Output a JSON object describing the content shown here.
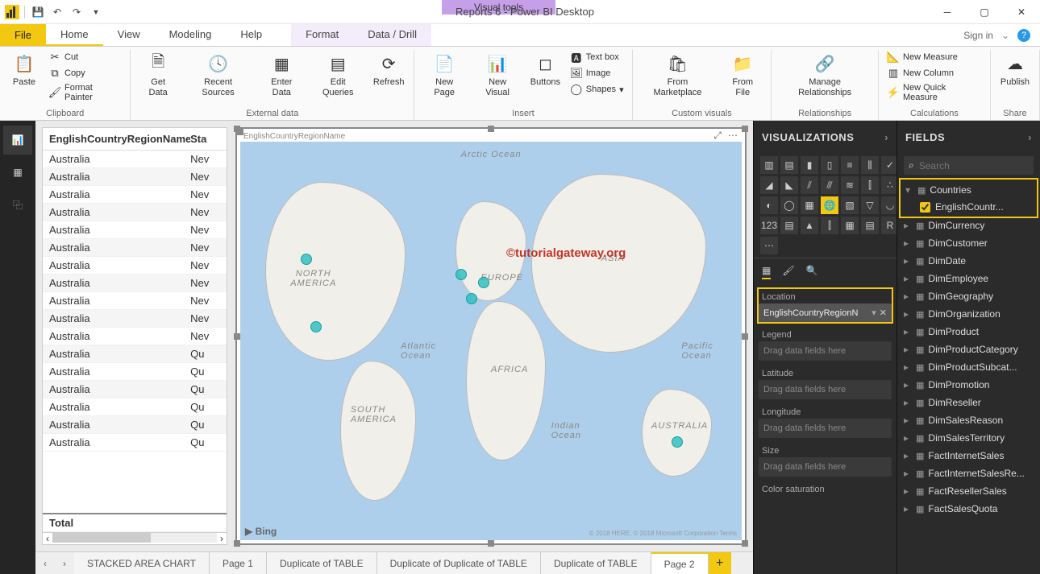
{
  "title_bar": {
    "app_title": "Reports 6 - Power BI Desktop",
    "context_tools": "Visual tools",
    "qat": {
      "save": "💾",
      "undo": "↶",
      "redo": "↷"
    }
  },
  "menu": {
    "file": "File",
    "home": "Home",
    "view": "View",
    "modeling": "Modeling",
    "help": "Help",
    "format": "Format",
    "datadrill": "Data / Drill",
    "signin": "Sign in"
  },
  "ribbon": {
    "clipboard": {
      "label": "Clipboard",
      "paste": "Paste",
      "cut": "Cut",
      "copy": "Copy",
      "fmtpainter": "Format Painter"
    },
    "external": {
      "label": "External data",
      "getdata": "Get\nData",
      "recent": "Recent\nSources",
      "enter": "Enter\nData",
      "edit": "Edit\nQueries",
      "refresh": "Refresh"
    },
    "insert": {
      "label": "Insert",
      "newpage": "New\nPage",
      "newvisual": "New\nVisual",
      "buttons": "Buttons",
      "textbox": "Text box",
      "image": "Image",
      "shapes": "Shapes"
    },
    "custom": {
      "label": "Custom visuals",
      "market": "From\nMarketplace",
      "file": "From\nFile"
    },
    "relationships": {
      "label": "Relationships",
      "manage": "Manage\nRelationships"
    },
    "calc": {
      "label": "Calculations",
      "newmeasure": "New Measure",
      "newcolumn": "New Column",
      "newquick": "New Quick Measure"
    },
    "share": {
      "label": "Share",
      "publish": "Publish"
    }
  },
  "table_visual": {
    "col1": "EnglishCountryRegionName",
    "col2": "Sta",
    "rows": [
      [
        "Australia",
        "Nev"
      ],
      [
        "Australia",
        "Nev"
      ],
      [
        "Australia",
        "Nev"
      ],
      [
        "Australia",
        "Nev"
      ],
      [
        "Australia",
        "Nev"
      ],
      [
        "Australia",
        "Nev"
      ],
      [
        "Australia",
        "Nev"
      ],
      [
        "Australia",
        "Nev"
      ],
      [
        "Australia",
        "Nev"
      ],
      [
        "Australia",
        "Nev"
      ],
      [
        "Australia",
        "Nev"
      ],
      [
        "Australia",
        "Qu"
      ],
      [
        "Australia",
        "Qu"
      ],
      [
        "Australia",
        "Qu"
      ],
      [
        "Australia",
        "Qu"
      ],
      [
        "Australia",
        "Qu"
      ],
      [
        "Australia",
        "Qu"
      ]
    ],
    "total": "Total"
  },
  "map_visual": {
    "field_title": "EnglishCountryRegionName",
    "labels": {
      "na": "NORTH\nAMERICA",
      "sa": "SOUTH\nAMERICA",
      "af": "AFRICA",
      "eu": "EUROPE",
      "as": "ASIA",
      "au": "AUSTRALIA",
      "arctic": "Arctic Ocean",
      "atl": "Atlantic\nOcean",
      "ind": "Indian\nOcean",
      "pac": "Pacific\nOcean"
    },
    "watermark": "©tutorialgateway.org",
    "bing": "▶ Bing",
    "credit": "© 2018 HERE, © 2018 Microsoft Corporation Terms"
  },
  "page_tabs": {
    "tabs": [
      "STACKED AREA CHART",
      "Page 1",
      "Duplicate of TABLE",
      "Duplicate of Duplicate of TABLE",
      "Duplicate of TABLE",
      "Page 2"
    ],
    "active": 5
  },
  "viz_pane": {
    "title": "VISUALIZATIONS"
  },
  "wells": {
    "location": {
      "label": "Location",
      "chip": "EnglishCountryRegionN"
    },
    "legend": {
      "label": "Legend",
      "drop": "Drag data fields here"
    },
    "latitude": {
      "label": "Latitude",
      "drop": "Drag data fields here"
    },
    "longitude": {
      "label": "Longitude",
      "drop": "Drag data fields here"
    },
    "size": {
      "label": "Size",
      "drop": "Drag data fields here"
    },
    "colorsat": {
      "label": "Color saturation"
    }
  },
  "fields_pane": {
    "title": "FIELDS",
    "search_placeholder": "Search",
    "tables": [
      {
        "name": "Countries",
        "expanded": true,
        "cols": [
          {
            "name": "EnglishCountr...",
            "checked": true
          }
        ]
      },
      {
        "name": "DimCurrency"
      },
      {
        "name": "DimCustomer"
      },
      {
        "name": "DimDate"
      },
      {
        "name": "DimEmployee"
      },
      {
        "name": "DimGeography"
      },
      {
        "name": "DimOrganization"
      },
      {
        "name": "DimProduct"
      },
      {
        "name": "DimProductCategory"
      },
      {
        "name": "DimProductSubcat..."
      },
      {
        "name": "DimPromotion"
      },
      {
        "name": "DimReseller"
      },
      {
        "name": "DimSalesReason"
      },
      {
        "name": "DimSalesTerritory"
      },
      {
        "name": "FactInternetSales"
      },
      {
        "name": "FactInternetSalesRe..."
      },
      {
        "name": "FactResellerSales"
      },
      {
        "name": "FactSalesQuota"
      }
    ]
  }
}
